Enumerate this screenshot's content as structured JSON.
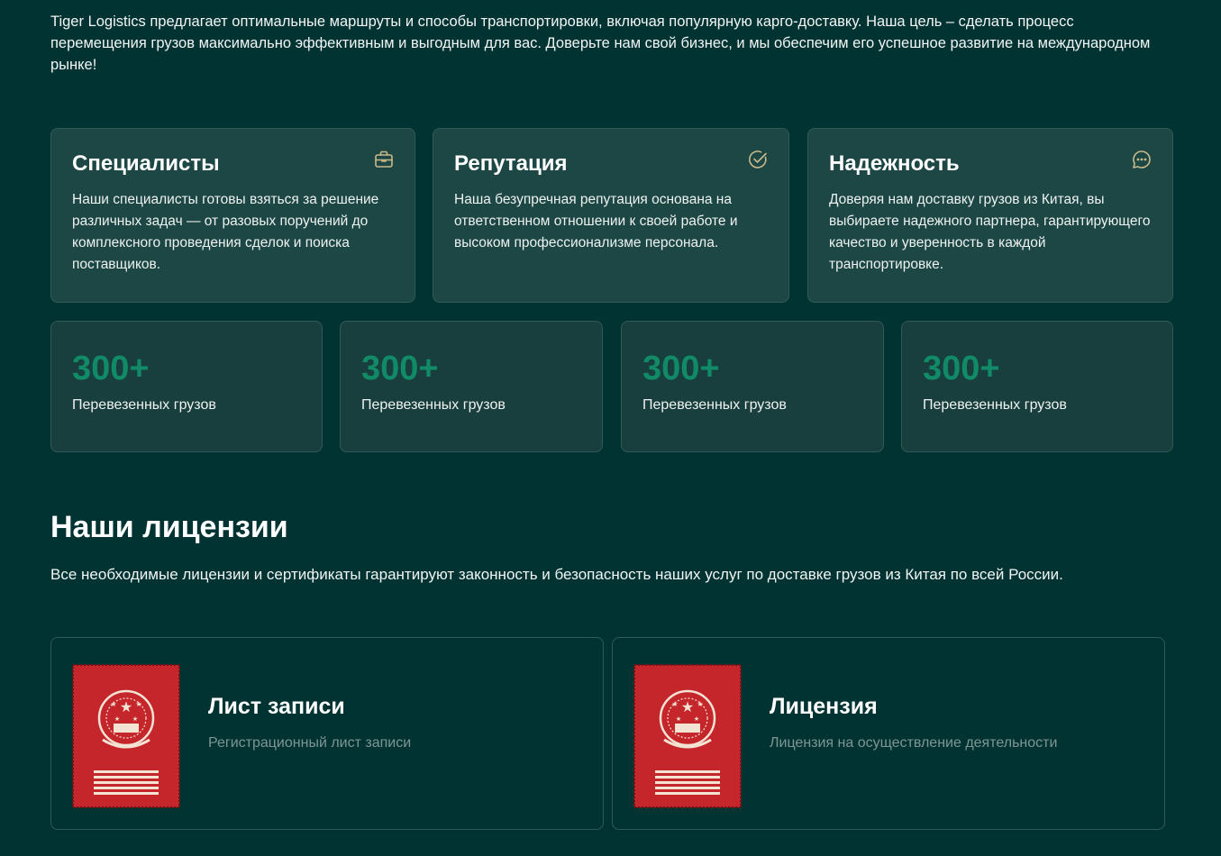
{
  "intro": {
    "text": "Tiger Logistics предлагает оптимальные маршруты и способы транспортировки, включая популярную карго-доставку. Наша цель – сделать процесс перемещения грузов максимально эффективным и выгодным для вас. Доверьте нам свой бизнес, и мы обеспечим его успешное развитие на международном рынке!"
  },
  "features": [
    {
      "title": "Специалисты",
      "text": "Наши специалисты готовы взяться за решение различных задач — от разовых поручений до комплексного проведения сделок и поиска поставщиков.",
      "icon": "briefcase-icon"
    },
    {
      "title": "Репутация",
      "text": "Наша безупречная репутация основана на ответственном отношении к своей работе и высоком профессионализме персонала.",
      "icon": "check-circle-icon"
    },
    {
      "title": "Надежность",
      "text": "Доверяя нам доставку грузов из Китая, вы выбираете надежного партнера, гарантирующего качество и уверенность в каждой транспортировке.",
      "icon": "chat-bubble-icon"
    }
  ],
  "stats": [
    {
      "value": "300+",
      "label": "Перевезенных грузов"
    },
    {
      "value": "300+",
      "label": "Перевезенных грузов"
    },
    {
      "value": "300+",
      "label": "Перевезенных грузов"
    },
    {
      "value": "300+",
      "label": "Перевезенных грузов"
    }
  ],
  "licenses": {
    "title": "Наши лицензии",
    "description": "Все необходимые лицензии и сертификаты гарантируют законность и безопасность наших услуг по доставке грузов из Китая по всей России.",
    "items": [
      {
        "title": "Лист записи",
        "subtitle": "Регистрационный лист записи",
        "icon": "state-emblem-document-icon"
      },
      {
        "title": "Лицензия",
        "subtitle": "Лицензия на осуществление деятельности",
        "icon": "state-emblem-document-icon"
      }
    ]
  },
  "colors": {
    "background": "#023333",
    "card": "#1c4745",
    "accent_icon": "#c9b98a",
    "stat_number": "#118a68",
    "document_red": "#c4262b"
  }
}
